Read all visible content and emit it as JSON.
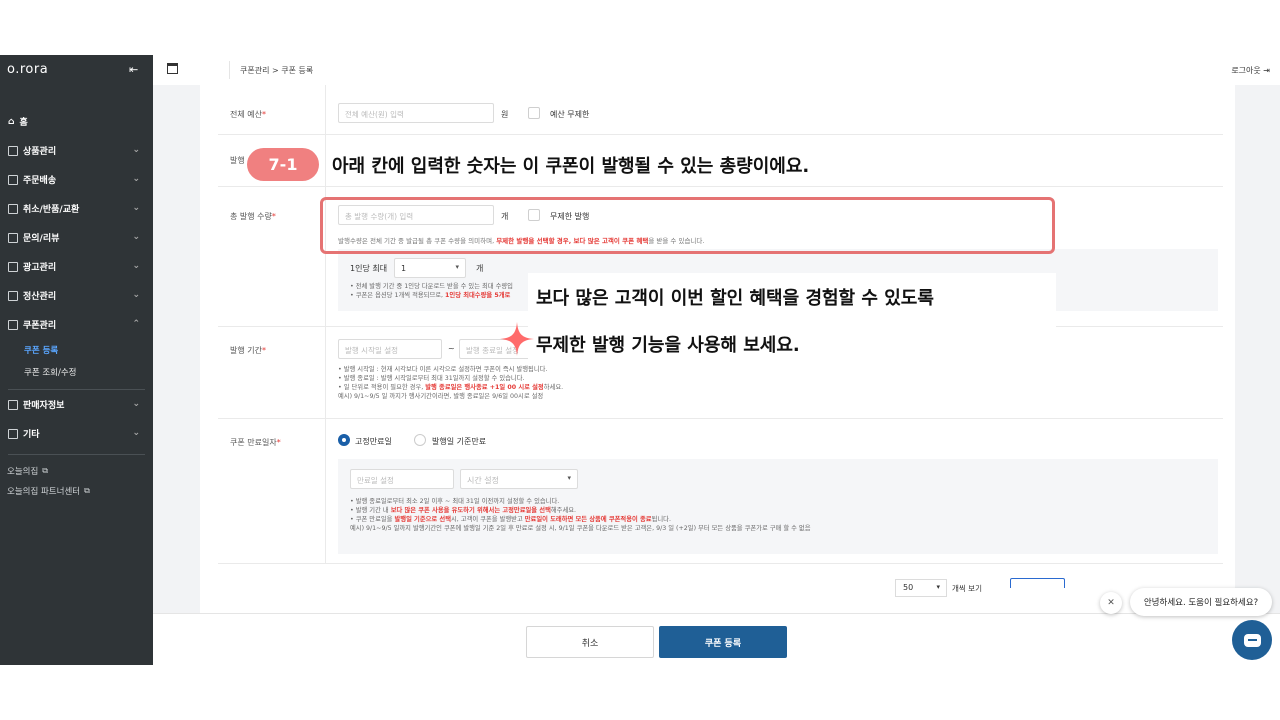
{
  "app": {
    "logo": "o.rora",
    "collapse_icon": "collapse-left-icon"
  },
  "sidebar": {
    "items": [
      {
        "label": "홈",
        "icon": "home-icon",
        "chevron": ""
      },
      {
        "label": "상품관리",
        "icon": "doc-icon",
        "chevron": "⌄"
      },
      {
        "label": "주문배송",
        "icon": "doc-icon",
        "chevron": "⌄"
      },
      {
        "label": "취소/반품/교환",
        "icon": "doc-icon",
        "chevron": "⌄"
      },
      {
        "label": "문의/리뷰",
        "icon": "doc-icon",
        "chevron": "⌄"
      },
      {
        "label": "광고관리",
        "icon": "doc-icon",
        "chevron": "⌄"
      },
      {
        "label": "정산관리",
        "icon": "doc-icon",
        "chevron": "⌄"
      },
      {
        "label": "쿠폰관리",
        "icon": "doc-icon",
        "chevron": "⌃"
      }
    ],
    "sub_items": [
      {
        "label": "쿠폰 등록",
        "active": true
      },
      {
        "label": "쿠폰 조회/수정",
        "active": false
      }
    ],
    "items_after": [
      {
        "label": "판매자정보",
        "chevron": "⌄"
      },
      {
        "label": "기타",
        "chevron": "⌄"
      }
    ],
    "external": [
      {
        "label": "오늘의집",
        "icon": "external-link-icon"
      },
      {
        "label": "오늘의집 파트너센터",
        "icon": "external-link-icon"
      }
    ]
  },
  "topbar": {
    "breadcrumb": "쿠폰관리  >  쿠폰 등록",
    "logout": "로그아웃 ⇥"
  },
  "form": {
    "budget": {
      "label": "전체 예산",
      "required": "*",
      "placeholder": "전체 예산(원) 입력",
      "unit": "원",
      "unlimited_label": "예산 무제한"
    },
    "issue_label_partial": "발행",
    "total_qty": {
      "label": "총 발행 수량",
      "required": "*",
      "placeholder": "총 발행 수량(개) 입력",
      "unit": "개",
      "unlimited_label": "무제한 발행",
      "desc_pre": "발행수량은 전체 기간 중 발급될 총 쿠폰 수량을 의미하며, ",
      "desc_hl": "무제한 발행을 선택할 경우, 보다 많은 고객이 쿠폰 혜택",
      "desc_post": "을 받을 수 있습니다."
    },
    "per_person": {
      "label": "1인당 최대",
      "value": "1",
      "unit": "개",
      "bullet1": "• 전체 발행 기간 중 1인당 다운로드 받을 수 있는 최대 수량입",
      "bullet2_pre": "• 쿠폰은 옵션당 1개씩 적용되므로, ",
      "bullet2_hl": "1인당 최대수량을 5개로"
    },
    "period": {
      "label": "발행 기간",
      "required": "*",
      "start_placeholder": "발행 시작일 설정",
      "dash": "~",
      "end_placeholder": "발행 종료일 설정",
      "bullet1": "• 발행 시작일 : 현재 시각보다 이른 시각으로 설정하면 쿠폰이 즉시 발행됩니다.",
      "bullet2": "• 발행 종료일 : 발행 시작일로부터 최대 31일까지 설정할 수 있습니다.",
      "bullet3_pre": "• 일 단위로 적용이 필요한 경우, ",
      "bullet3_hl": "발행 종료일은 행사종료 +1일 00 시로 설정",
      "bullet3_post": "하세요.",
      "bullet4": "  예시) 9/1~9/5 일 까지가 행사기간이라면, 발행 종료일은 9/6일 00시로 설정"
    },
    "expiry": {
      "label": "쿠폰 만료일자",
      "required": "*",
      "option1": "고정만료일",
      "option2": "발행일 기준만료",
      "date_placeholder": "만료일 설정",
      "time_placeholder": "시간 설정",
      "bullet1": "• 발행 종료일로부터 최소 2일 이후 ~ 최대 31일 이전까지 설정할 수 있습니다.",
      "bullet2_pre": "• 발행 기간 내 ",
      "bullet2_hl": "보다 많은 쿠폰 사용을 유도하기 위해서는 고정만료일을 선택",
      "bullet2_post": "해주세요.",
      "bullet3_pre": "• 쿠폰 만료일을 ",
      "bullet3_hl1": "발행일 기준으로 선택",
      "bullet3_mid": "시, 고객이 쿠폰을 발행받고 ",
      "bullet3_hl2": "만료일이 도래하면 모든 상품에 쿠폰적용이 종료",
      "bullet3_post": "됩니다.",
      "bullet4": "  예시) 9/1~9/5 일까지 발행기간인 쿠폰에 발행일 기준 2일 후 만료로 설정 시, 9/1일 쿠폰을 다운로드 받은 고객은, 9/3 일 (+2일) 부터 모든 상품을 쿠폰가로 구매 할 수 없음"
    }
  },
  "pager": {
    "size": "50",
    "text": "개씩 보기"
  },
  "buttons": {
    "cancel": "취소",
    "submit": "쿠폰 등록"
  },
  "chat": {
    "close": "✕",
    "greeting": "안녕하세요. 도움이 필요하세요?"
  },
  "annotation": {
    "badge": "7-1",
    "caption1": "아래 칸에 입력한 숫자는 이 쿠폰이 발행될 수 있는 총량이에요.",
    "caption2": "보다 많은 고객이 이번 할인 혜택을 경험할 수 있도록",
    "caption3": "무제한 발행 기능을 사용해 보세요.",
    "accent_color": "#f08080",
    "star_color": "#ff6b6b"
  }
}
